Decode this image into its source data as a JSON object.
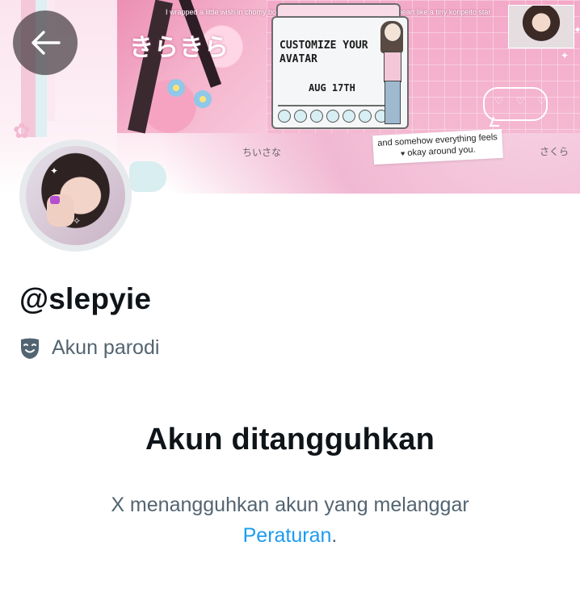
{
  "banner": {
    "caption": "I wrapped a little wish in chomy bow and paper — maybe it'll reach your heart like a tiny konpeito star",
    "kirakira": "きらきら",
    "window_title": "CUSTOMIZE YOUR AVATAR",
    "window_date": "AUG 17TH",
    "label_left": "ちいさな",
    "label_right": "さくら",
    "note_line1": "and somehow everything feels",
    "note_line2": "okay around you.",
    "chat_dots": "♡ ♡ ♡"
  },
  "navigation": {
    "back_icon": "arrow-left-icon"
  },
  "profile": {
    "username": "@slepyie",
    "parody_icon": "theater-mask-icon",
    "parody_label": "Akun parodi"
  },
  "suspension": {
    "title": "Akun ditangguhkan",
    "body_text": "X menangguhkan akun yang melanggar",
    "link_text": "Peraturan",
    "trailing_punct": "."
  },
  "colors": {
    "text_primary": "#0f1419",
    "text_secondary": "#536471",
    "link": "#1d9bf0",
    "back_button_bg": "#463e42"
  }
}
